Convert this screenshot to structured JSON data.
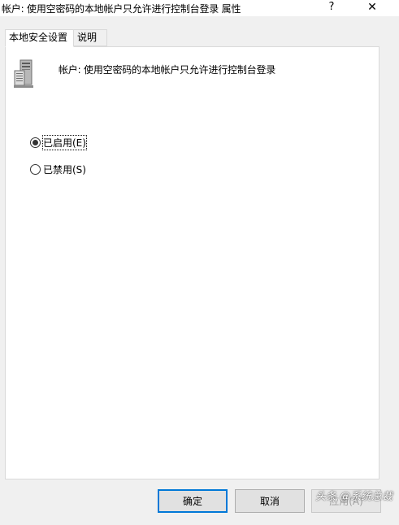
{
  "window": {
    "title": "帐户: 使用空密码的本地帐户只允许进行控制台登录 属性",
    "help_label": "?",
    "close_label": "✕"
  },
  "tabs": [
    {
      "label": "本地安全设置",
      "active": true
    },
    {
      "label": "说明",
      "active": false
    }
  ],
  "policy": {
    "icon": "server-icon",
    "title": "帐户: 使用空密码的本地帐户只允许进行控制台登录"
  },
  "options": [
    {
      "label": "已启用(E)",
      "checked": true
    },
    {
      "label": "已禁用(S)",
      "checked": false
    }
  ],
  "buttons": {
    "ok": "确定",
    "cancel": "取消",
    "apply": "应用(A)"
  },
  "watermark": "头条 @系统总裁",
  "colors": {
    "accent": "#0078d7",
    "dialog_bg": "#f0f0f0",
    "panel_bg": "#ffffff"
  }
}
